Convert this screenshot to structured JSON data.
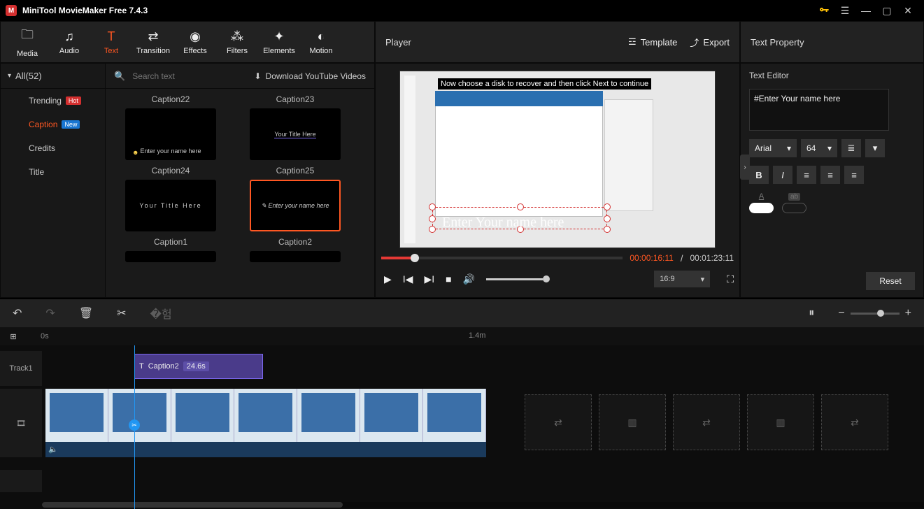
{
  "app": {
    "title": "MiniTool MovieMaker Free 7.4.3"
  },
  "toolbar": {
    "media": "Media",
    "audio": "Audio",
    "text": "Text",
    "transition": "Transition",
    "effects": "Effects",
    "filters": "Filters",
    "elements": "Elements",
    "motion": "Motion"
  },
  "player": {
    "label": "Player",
    "template": "Template",
    "export": "Export",
    "banner": "Now choose a disk to recover and then click Next to continue",
    "caption_text": "Enter Your name here",
    "time_current": "00:00:16:11",
    "time_sep": "/",
    "time_total": "00:01:23:11",
    "aspect": "16:9"
  },
  "property": {
    "title": "Text Property",
    "editor_label": "Text Editor",
    "text_value": "#Enter Your name here",
    "font": "Arial",
    "size": "64",
    "reset": "Reset"
  },
  "sidebar": {
    "all": "All(52)",
    "items": [
      {
        "label": "Trending",
        "badge": "Hot",
        "badge_class": "hot"
      },
      {
        "label": "Caption",
        "badge": "New",
        "badge_class": "new",
        "active": true
      },
      {
        "label": "Credits"
      },
      {
        "label": "Title"
      }
    ],
    "search_placeholder": "Search text",
    "download": "Download YouTube Videos"
  },
  "templates": [
    {
      "label": "Caption22"
    },
    {
      "label": "Caption23"
    },
    {
      "label": "Caption24"
    },
    {
      "label": "Caption25"
    },
    {
      "label": "Caption1"
    },
    {
      "label": "Caption2",
      "selected": true
    }
  ],
  "timeline": {
    "zero": "0s",
    "mark": "1.4m",
    "track1": "Track1",
    "clip": {
      "name": "Caption2",
      "duration": "24.6s"
    }
  }
}
